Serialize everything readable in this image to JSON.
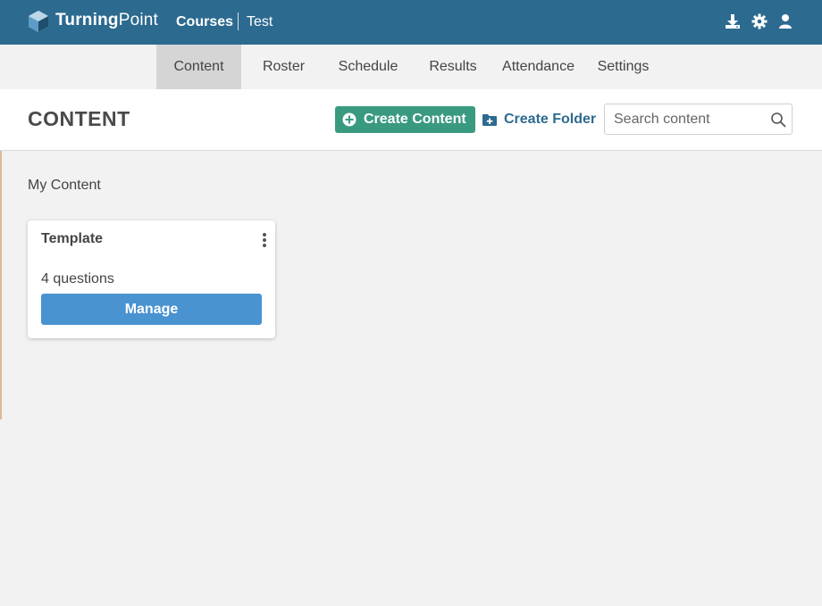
{
  "app": {
    "brand_bold": "Turning",
    "brand_light": "Point",
    "breadcrumb": [
      "Courses",
      "Test"
    ]
  },
  "top_icons": [
    "download-icon",
    "gear-icon",
    "user-icon"
  ],
  "tabs": [
    {
      "label": "Content",
      "active": true
    },
    {
      "label": "Roster",
      "active": false
    },
    {
      "label": "Schedule",
      "active": false
    },
    {
      "label": "Results",
      "active": false
    },
    {
      "label": "Attendance",
      "active": false
    },
    {
      "label": "Settings",
      "active": false
    }
  ],
  "header": {
    "title": "CONTENT",
    "create_content_label": "Create Content",
    "create_folder_label": "Create Folder",
    "search_placeholder": "Search content",
    "search_value": ""
  },
  "main": {
    "section_label": "My Content",
    "cards": [
      {
        "title": "Template",
        "count": "4 questions",
        "button": "Manage"
      }
    ]
  },
  "colors": {
    "topbar": "#2d6a90",
    "create_button": "#3a9a7f",
    "manage_button": "#4a93d1",
    "active_tab": "#d5d5d5",
    "background": "#f2f2f2"
  }
}
